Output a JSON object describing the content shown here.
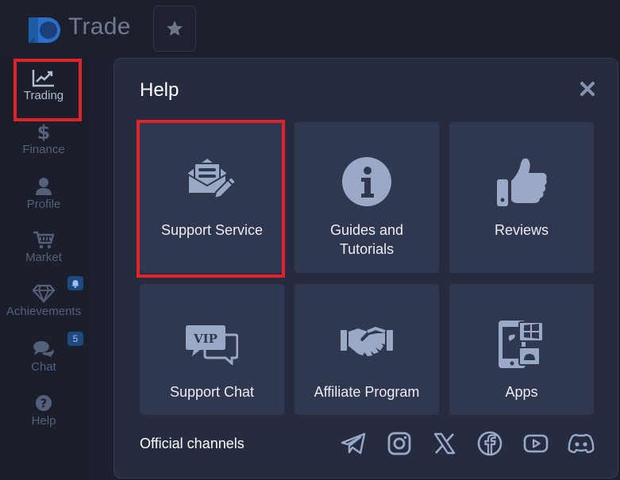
{
  "topbar": {
    "brand": "Trade",
    "favorite_icon": "star-icon"
  },
  "sidebar": {
    "items": [
      {
        "label": "Trading",
        "icon": "chart-line-icon",
        "active": true
      },
      {
        "label": "Finance",
        "icon": "dollar-icon"
      },
      {
        "label": "Profile",
        "icon": "user-icon"
      },
      {
        "label": "Market",
        "icon": "cart-icon"
      },
      {
        "label": "Achievements",
        "icon": "diamond-icon",
        "badge_icon": "bell-icon"
      },
      {
        "label": "Chat",
        "icon": "chat-icon",
        "badge": "5"
      },
      {
        "label": "Help",
        "icon": "question-icon"
      }
    ]
  },
  "modal": {
    "title": "Help",
    "tiles": [
      {
        "label": "Support Service",
        "icon": "envelope-edit-icon"
      },
      {
        "label": "Guides and Tutorials",
        "icon": "info-icon"
      },
      {
        "label": "Reviews",
        "icon": "thumbs-up-icon"
      },
      {
        "label": "Support Chat",
        "icon": "vip-chat-icon",
        "icon_text": "VIP"
      },
      {
        "label": "Affiliate Program",
        "icon": "handshake-icon"
      },
      {
        "label": "Apps",
        "icon": "devices-icon"
      }
    ],
    "channels_label": "Official channels",
    "channels": [
      "telegram-icon",
      "instagram-icon",
      "x-icon",
      "facebook-icon",
      "youtube-icon",
      "discord-icon"
    ]
  },
  "colors": {
    "highlight": "#e1222a",
    "tile_bg": "#303850",
    "icon": "#9aaac6"
  }
}
